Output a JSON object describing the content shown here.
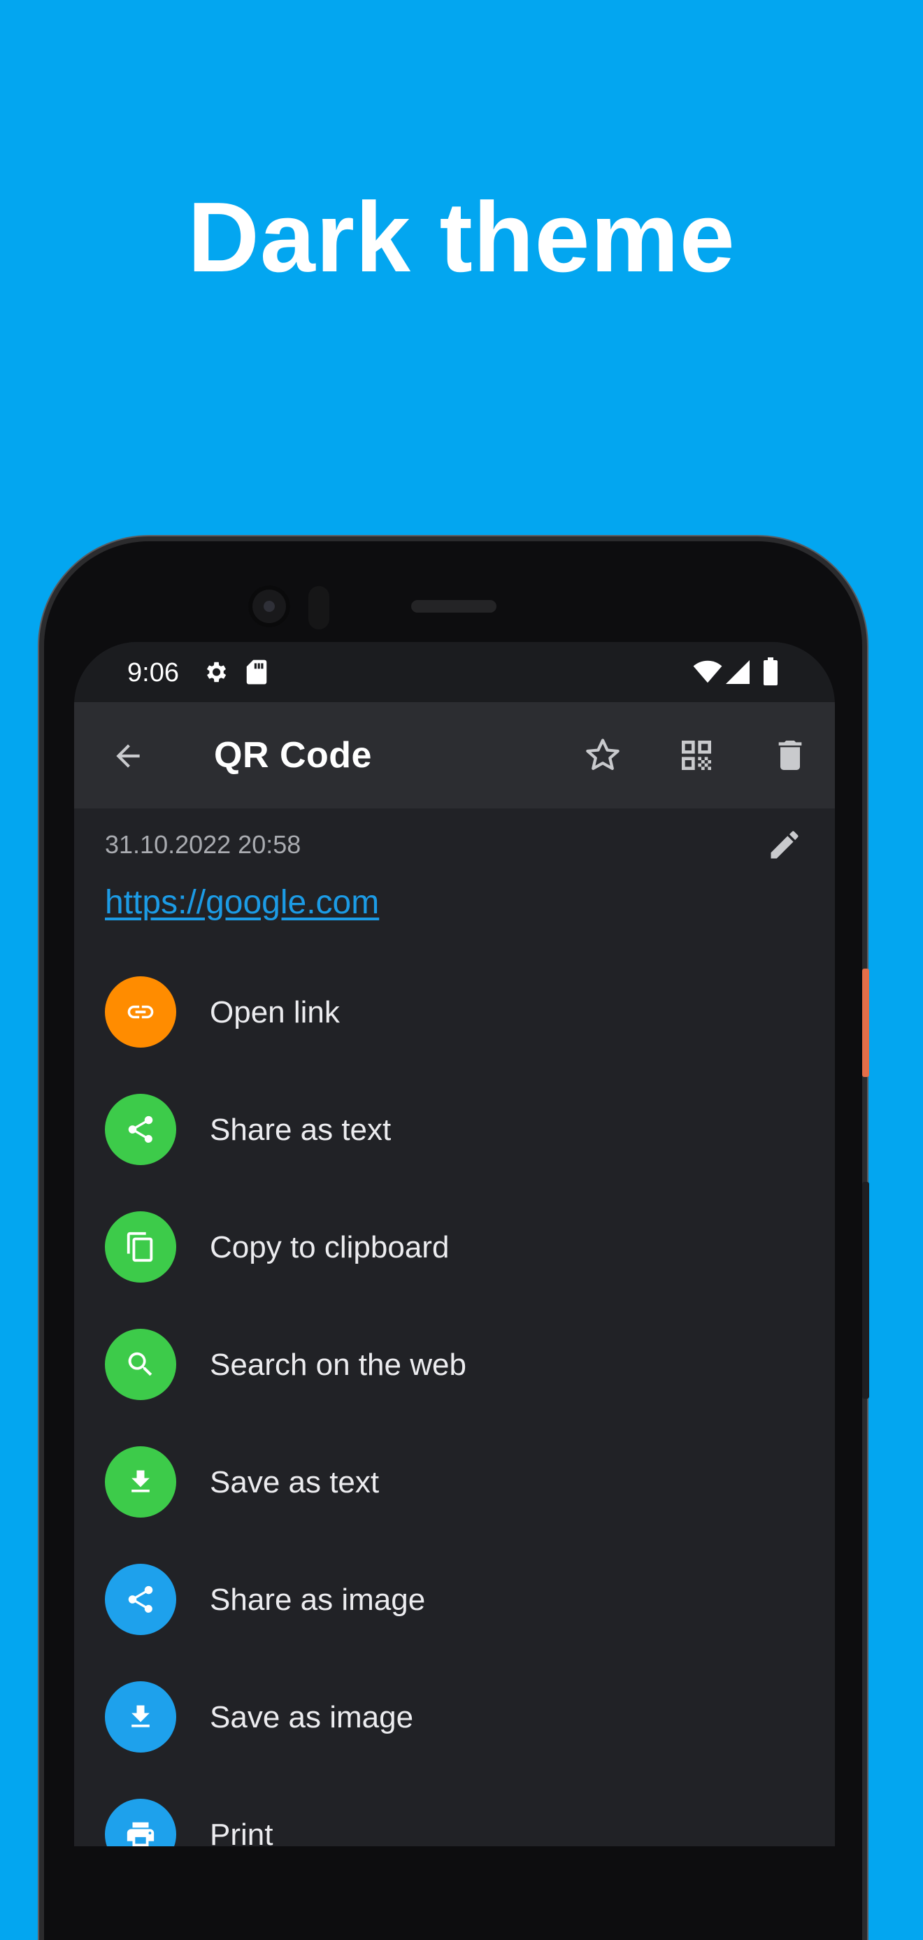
{
  "promo": {
    "title": "Dark theme"
  },
  "status_bar": {
    "time": "9:06"
  },
  "app_bar": {
    "title": "QR Code",
    "icons": [
      "back-arrow-icon",
      "star-outline-icon",
      "qr-code-icon",
      "trash-icon"
    ]
  },
  "record": {
    "date": "31.10.2022 20:58",
    "url": "https://google.com"
  },
  "colors": {
    "background": "#03a6f0",
    "screen": "#212226",
    "app_bar": "#2c2d31",
    "orange": "#ff8c00",
    "green": "#3dcb4a",
    "blue": "#1ea1ec",
    "link": "#1c9be5"
  },
  "actions": [
    {
      "label": "Open link",
      "icon": "link-icon",
      "color": "#ff8c00"
    },
    {
      "label": "Share as text",
      "icon": "share-icon",
      "color": "#3dcb4a"
    },
    {
      "label": "Copy to clipboard",
      "icon": "copy-icon",
      "color": "#3dcb4a"
    },
    {
      "label": "Search on the web",
      "icon": "search-icon",
      "color": "#3dcb4a"
    },
    {
      "label": "Save as text",
      "icon": "download-icon",
      "color": "#3dcb4a"
    },
    {
      "label": "Share as image",
      "icon": "share-icon",
      "color": "#1ea1ec"
    },
    {
      "label": "Save as image",
      "icon": "download-icon",
      "color": "#1ea1ec"
    },
    {
      "label": "Print",
      "icon": "print-icon",
      "color": "#1ea1ec"
    }
  ]
}
